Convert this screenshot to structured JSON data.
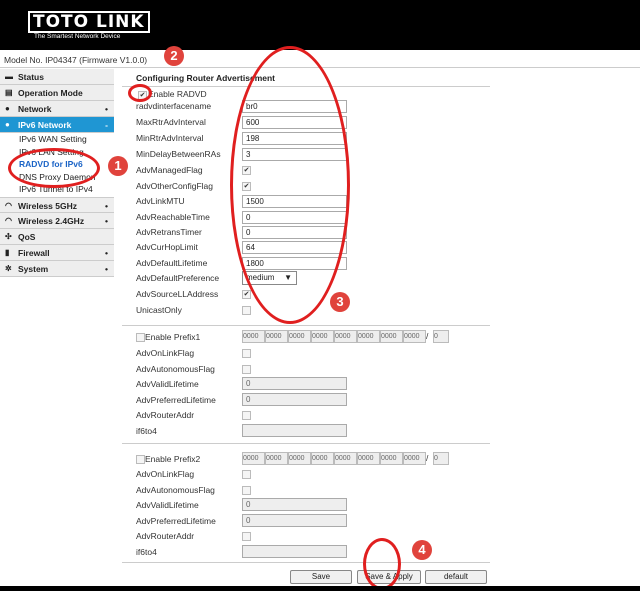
{
  "header": {
    "brand": "TOTO LINK",
    "tagline": "The Smartest Network Device"
  },
  "model_line": "Model No. IP04347 (Firmware V1.0.0)",
  "sidebar": {
    "items": [
      {
        "label": "Status",
        "icon": "monitor-icon"
      },
      {
        "label": "Operation Mode",
        "icon": "operation-icon"
      },
      {
        "label": "Network",
        "icon": "globe-icon",
        "dot": "•"
      },
      {
        "label": "IPv6 Network",
        "icon": "globe-icon",
        "dot": "-"
      },
      {
        "label": "Wireless 5GHz",
        "icon": "wifi-icon",
        "dot": "•"
      },
      {
        "label": "Wireless 2.4GHz",
        "icon": "wifi-icon",
        "dot": "•"
      },
      {
        "label": "QoS",
        "icon": "qos-icon"
      },
      {
        "label": "Firewall",
        "icon": "lock-icon",
        "dot": "•"
      },
      {
        "label": "System",
        "icon": "gear-icon",
        "dot": "•"
      }
    ],
    "ipv6_sub": [
      "IPv6 WAN Setting",
      "IPv6 LAN Setting",
      "RADVD for IPv6",
      "DNS Proxy Daemon",
      "IPv6 Tunnel to IPv4"
    ]
  },
  "page_title": "Configuring Router Advertisement",
  "enable_radvd": "Enable RADVD",
  "fields": [
    {
      "label": "radvdinterfacename",
      "value": "br0"
    },
    {
      "label": "MaxRtrAdvInterval",
      "value": "600"
    },
    {
      "label": "MinRtrAdvInterval",
      "value": "198"
    },
    {
      "label": "MinDelayBetweenRAs",
      "value": "3"
    },
    {
      "label": "AdvManagedFlag"
    },
    {
      "label": "AdvOtherConfigFlag"
    },
    {
      "label": "AdvLinkMTU",
      "value": "1500"
    },
    {
      "label": "AdvReachableTime",
      "value": "0"
    },
    {
      "label": "AdvRetransTimer",
      "value": "0"
    },
    {
      "label": "AdvCurHopLimit",
      "value": "64"
    },
    {
      "label": "AdvDefaultLifetime",
      "value": "1800"
    },
    {
      "label": "AdvDefaultPreference",
      "value": "medium"
    },
    {
      "label": "AdvSourceLLAddress"
    },
    {
      "label": "UnicastOnly"
    }
  ],
  "prefix1": {
    "enable": "Enable Prefix1",
    "octets": [
      "0000",
      "0000",
      "0000",
      "0000",
      "0000",
      "0000",
      "0000",
      "0000"
    ],
    "slash": "/",
    "length": "0",
    "on_link": "AdvOnLinkFlag",
    "autonomous": "AdvAutonomousFlag",
    "valid_label": "AdvValidLifetime",
    "valid_value": "0",
    "preferred_label": "AdvPreferredLifetime",
    "preferred_value": "0",
    "router_addr": "AdvRouterAddr",
    "if6to4": "if6to4"
  },
  "prefix2": {
    "enable": "Enable Prefix2",
    "octets": [
      "0000",
      "0000",
      "0000",
      "0000",
      "0000",
      "0000",
      "0000",
      "0000"
    ],
    "slash": "/",
    "length": "0",
    "on_link": "AdvOnLinkFlag",
    "autonomous": "AdvAutonomousFlag",
    "valid_label": "AdvValidLifetime",
    "valid_value": "0",
    "preferred_label": "AdvPreferredLifetime",
    "preferred_value": "0",
    "router_addr": "AdvRouterAddr",
    "if6to4": "if6to4"
  },
  "buttons": {
    "save": "Save",
    "save_apply": "Save & Apply",
    "default": "default"
  },
  "annotations": [
    "1",
    "2",
    "3",
    "4"
  ],
  "colors": {
    "accent": "#1f96d3",
    "annotation": "#e01f1f",
    "current_link": "#1a63c6"
  }
}
